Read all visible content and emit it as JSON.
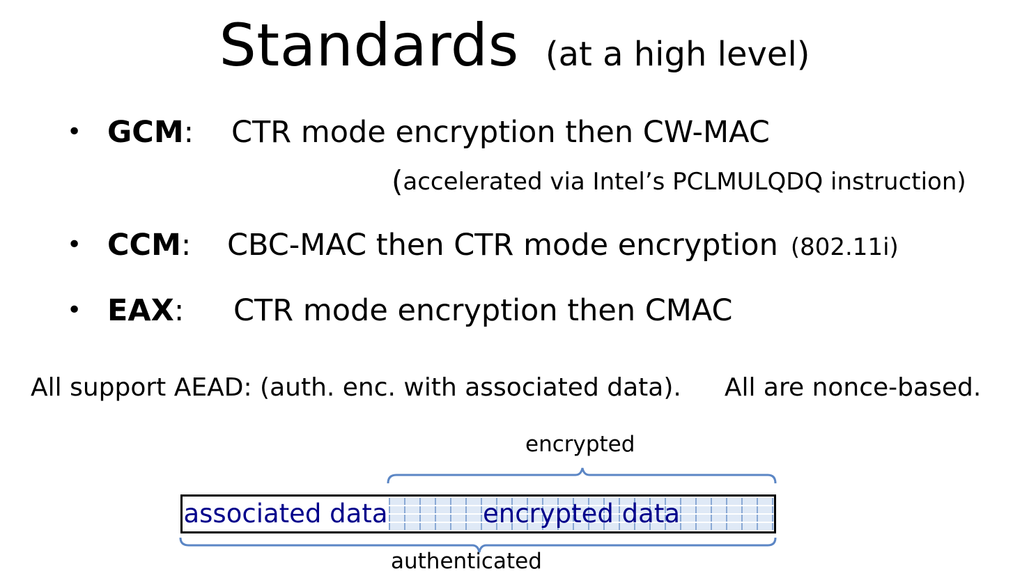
{
  "title": {
    "main": "Standards",
    "sub": "(at a high level)"
  },
  "bullets": [
    {
      "label": "GCM",
      "colon": ":",
      "text": "CTR mode encryption  then   CW-MAC"
    },
    {
      "label": "CCM",
      "colon": ":",
      "text": "CBC-MAC   then   CTR mode encryption",
      "note": "(802.11i)"
    },
    {
      "label": "EAX",
      "colon": ":",
      "text": "CTR mode encryption  then  CMAC"
    }
  ],
  "gcm_note": {
    "open": "(",
    "text": "accelerated via Intel’s PCLMULQDQ instruction)"
  },
  "aead": {
    "left": "All support AEAD:  (auth. enc. with associated data).",
    "right": "All are nonce-based."
  },
  "diagram": {
    "encrypted_label": "encrypted",
    "associated_box": "associated data",
    "encrypted_box": "encrypted data",
    "authenticated_label": "authenticated",
    "bracket_color": "#5b86c5",
    "box_text_color": "#00008b"
  }
}
